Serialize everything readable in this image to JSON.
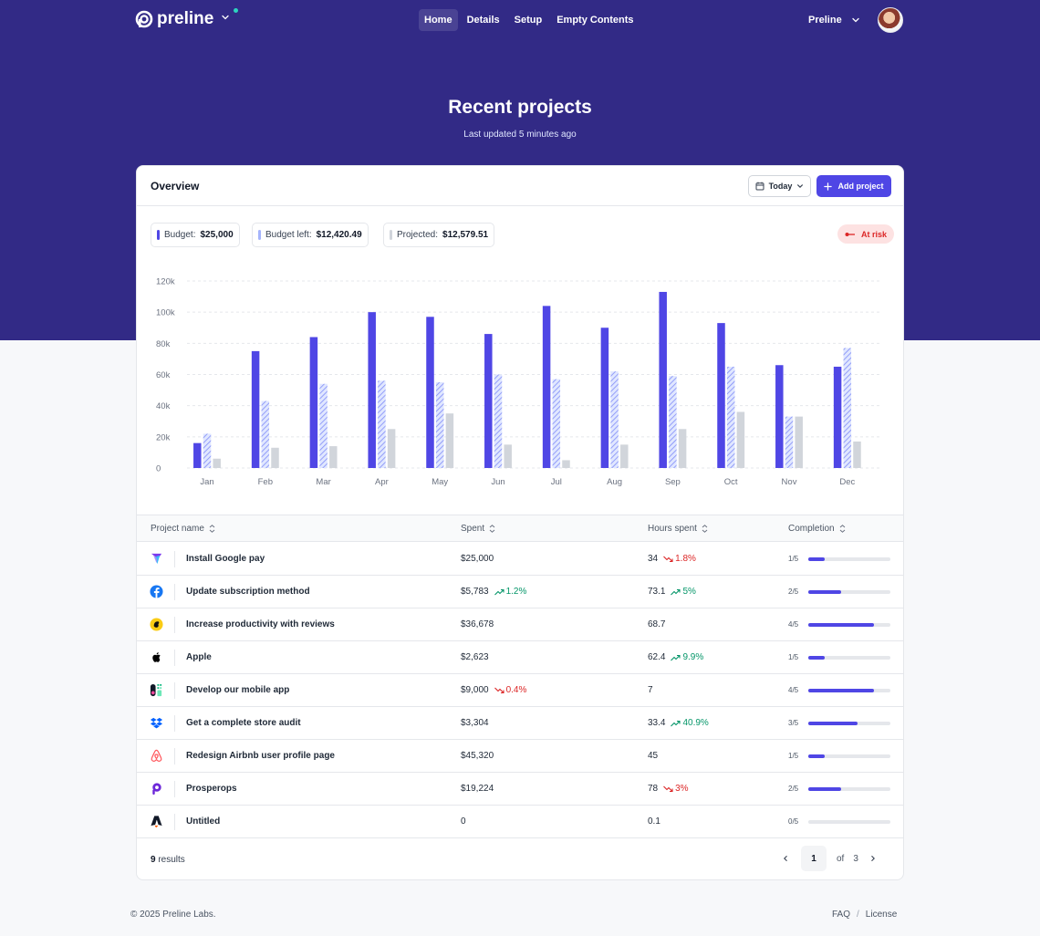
{
  "nav": {
    "brand": "preline",
    "links": [
      {
        "label": "Home",
        "active": true
      },
      {
        "label": "Details",
        "active": false
      },
      {
        "label": "Setup",
        "active": false
      },
      {
        "label": "Empty Contents",
        "active": false
      }
    ],
    "account": "Preline"
  },
  "hero": {
    "title": "Recent projects",
    "subtitle": "Last updated 5 minutes ago"
  },
  "card": {
    "title": "Overview",
    "date_button": "Today",
    "add_button": "Add project",
    "status_badge": "At risk",
    "legend": [
      {
        "label": "Budget:",
        "value": "$25,000",
        "color": "#4f46e5"
      },
      {
        "label": "Budget left:",
        "value": "$12,420.49",
        "color": "#a5b4fc"
      },
      {
        "label": "Projected:",
        "value": "$12,579.51",
        "color": "#d1d5db"
      }
    ]
  },
  "chart_data": {
    "type": "bar",
    "categories": [
      "Jan",
      "Feb",
      "Mar",
      "Apr",
      "May",
      "Jun",
      "Jul",
      "Aug",
      "Sep",
      "Oct",
      "Nov",
      "Dec"
    ],
    "series": [
      {
        "color": "#4f46e5",
        "style": "solid",
        "values": [
          16,
          75,
          84,
          100,
          97,
          86,
          104,
          90,
          113,
          93,
          66,
          65
        ]
      },
      {
        "color": "#a5b4fc",
        "style": "hatched",
        "values": [
          22,
          43,
          54,
          56,
          55,
          60,
          57,
          62,
          59,
          65,
          33,
          77
        ]
      },
      {
        "color": "#d1d5db",
        "style": "solid",
        "values": [
          6,
          13,
          14,
          25,
          35,
          15,
          5,
          15,
          25,
          36,
          33,
          17
        ]
      }
    ],
    "yticks": [
      "0",
      "20k",
      "40k",
      "60k",
      "80k",
      "100k",
      "120k"
    ],
    "ylim": [
      0,
      120
    ],
    "grid": true
  },
  "table": {
    "headers": [
      "Project name",
      "Spent",
      "Hours spent",
      "Completion"
    ],
    "rows": [
      {
        "icon": "google-pay-icon",
        "name": "Install Google pay",
        "spent": "$25,000",
        "spent_trend": null,
        "spent_dir": null,
        "hours": "34",
        "hours_trend": "1.8%",
        "hours_dir": "down",
        "completion": "1/5",
        "fraction": 0.2
      },
      {
        "icon": "facebook-icon",
        "name": "Update subscription method",
        "spent": "$5,783",
        "spent_trend": "1.2%",
        "spent_dir": "up",
        "hours": "73.1",
        "hours_trend": "5%",
        "hours_dir": "up",
        "completion": "2/5",
        "fraction": 0.4
      },
      {
        "icon": "mailchimp-icon",
        "name": "Increase productivity with reviews",
        "spent": "$36,678",
        "spent_trend": null,
        "spent_dir": null,
        "hours": "68.7",
        "hours_trend": null,
        "hours_dir": null,
        "completion": "4/5",
        "fraction": 0.8
      },
      {
        "icon": "apple-icon",
        "name": "Apple",
        "spent": "$2,623",
        "spent_trend": null,
        "spent_dir": null,
        "hours": "62.4",
        "hours_trend": "9.9%",
        "hours_dir": "up",
        "completion": "1/5",
        "fraction": 0.2
      },
      {
        "icon": "mobile-app-icon",
        "name": "Develop our mobile app",
        "spent": "$9,000",
        "spent_trend": "0.4%",
        "spent_dir": "down",
        "hours": "7",
        "hours_trend": null,
        "hours_dir": null,
        "completion": "4/5",
        "fraction": 0.8
      },
      {
        "icon": "dropbox-icon",
        "name": "Get a complete store audit",
        "spent": "$3,304",
        "spent_trend": null,
        "spent_dir": null,
        "hours": "33.4",
        "hours_trend": "40.9%",
        "hours_dir": "up",
        "completion": "3/5",
        "fraction": 0.6
      },
      {
        "icon": "airbnb-icon",
        "name": "Redesign Airbnb user profile page",
        "spent": "$45,320",
        "spent_trend": null,
        "spent_dir": null,
        "hours": "45",
        "hours_trend": null,
        "hours_dir": null,
        "completion": "1/5",
        "fraction": 0.2
      },
      {
        "icon": "prosperops-icon",
        "name": "Prosperops",
        "spent": "$19,224",
        "spent_trend": null,
        "spent_dir": null,
        "hours": "78",
        "hours_trend": "3%",
        "hours_dir": "down",
        "completion": "2/5",
        "fraction": 0.4
      },
      {
        "icon": "astro-icon",
        "name": "Untitled",
        "spent": "0",
        "spent_trend": null,
        "spent_dir": null,
        "hours": "0.1",
        "hours_trend": null,
        "hours_dir": null,
        "completion": "0/5",
        "fraction": 0
      }
    ]
  },
  "footer_table": {
    "results_count": "9",
    "results_label": "results",
    "current_page": "1",
    "of_label": "of",
    "total_pages": "3"
  },
  "footer": {
    "copyright": "© 2025 Preline Labs.",
    "links": [
      "FAQ",
      "License"
    ],
    "separator": "/"
  }
}
